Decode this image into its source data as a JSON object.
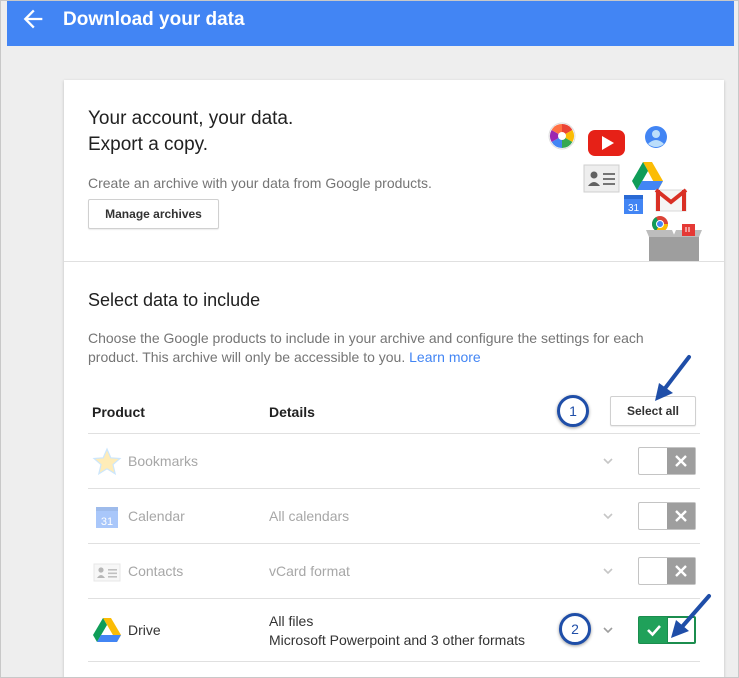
{
  "header": {
    "title": "Download your data",
    "back_icon": "arrow-left-icon",
    "color": "#4285f4"
  },
  "hero": {
    "title_line1": "Your account, your data.",
    "title_line2": "Export a copy.",
    "description": "Create an archive with your data from Google products.",
    "manage_archives_label": "Manage archives"
  },
  "select_section": {
    "title": "Select data to include",
    "description": "Choose the Google products to include in your archive and configure the settings for each product. This archive will only be accessible to you.",
    "learn_more_label": "Learn more",
    "select_all_label": "Select all"
  },
  "table": {
    "headers": {
      "product": "Product",
      "details": "Details"
    },
    "rows": [
      {
        "name": "Bookmarks",
        "details": "",
        "details_line2": "",
        "icon": "star-icon",
        "enabled": false
      },
      {
        "name": "Calendar",
        "details": "All calendars",
        "details_line2": "",
        "icon": "calendar-icon",
        "enabled": false
      },
      {
        "name": "Contacts",
        "details": "vCard format",
        "details_line2": "",
        "icon": "contacts-icon",
        "enabled": false
      },
      {
        "name": "Drive",
        "details": "All files",
        "details_line2": "Microsoft Powerpoint and 3 other formats",
        "icon": "drive-icon",
        "enabled": true
      }
    ]
  },
  "annotations": {
    "badge1": "1",
    "badge2": "2",
    "color": "#1f4ea8"
  },
  "colors": {
    "accent": "#4285f4",
    "toggle_on": "#20a15a",
    "toggle_off_knob": "#9e9e9e"
  }
}
